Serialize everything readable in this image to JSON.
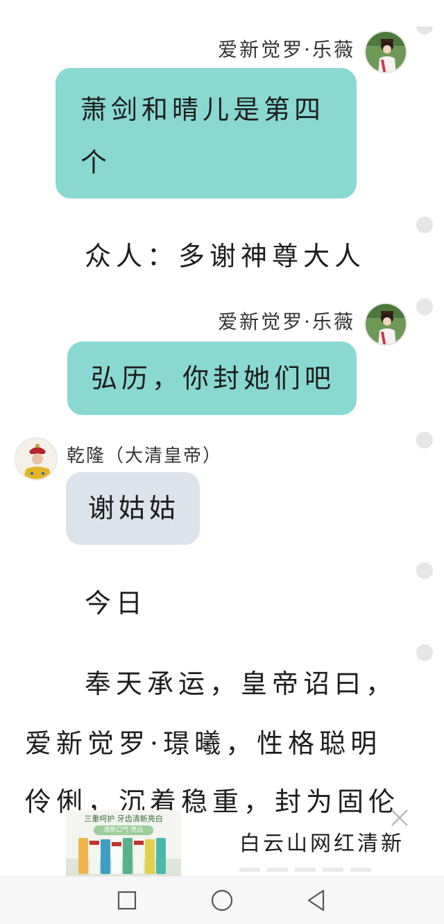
{
  "chat": {
    "messages": [
      {
        "sender": "爱新觉罗·乐薇",
        "line1": "萧剑和晴儿是第四",
        "line2": "个"
      },
      {
        "narration": "众人：多谢神尊大人"
      },
      {
        "sender": "爱新觉罗·乐薇",
        "text": "弘历，你封她们吧"
      },
      {
        "sender": "乾隆（大清皇帝）",
        "text": "谢姑姑"
      },
      {
        "narration": "今日"
      },
      {
        "edict_line1": "奉天承运，皇帝诏曰，",
        "edict_line2": "爱新觉罗·璟曦，性格聪明",
        "edict_line3": "伶俐，沉着稳重，封为固伦"
      }
    ]
  },
  "ad": {
    "banner_text": "三重呵护 牙齿清新亮白",
    "pill_text": "清新口气·亮白",
    "title": "白云山网红清新",
    "close_icon": "close-icon"
  },
  "navbar": {
    "buttons": [
      "recent-apps-icon",
      "home-icon",
      "back-icon"
    ]
  },
  "colors": {
    "teal_bubble": "#8ad8d2",
    "gray_bubble": "#dde3ea"
  }
}
